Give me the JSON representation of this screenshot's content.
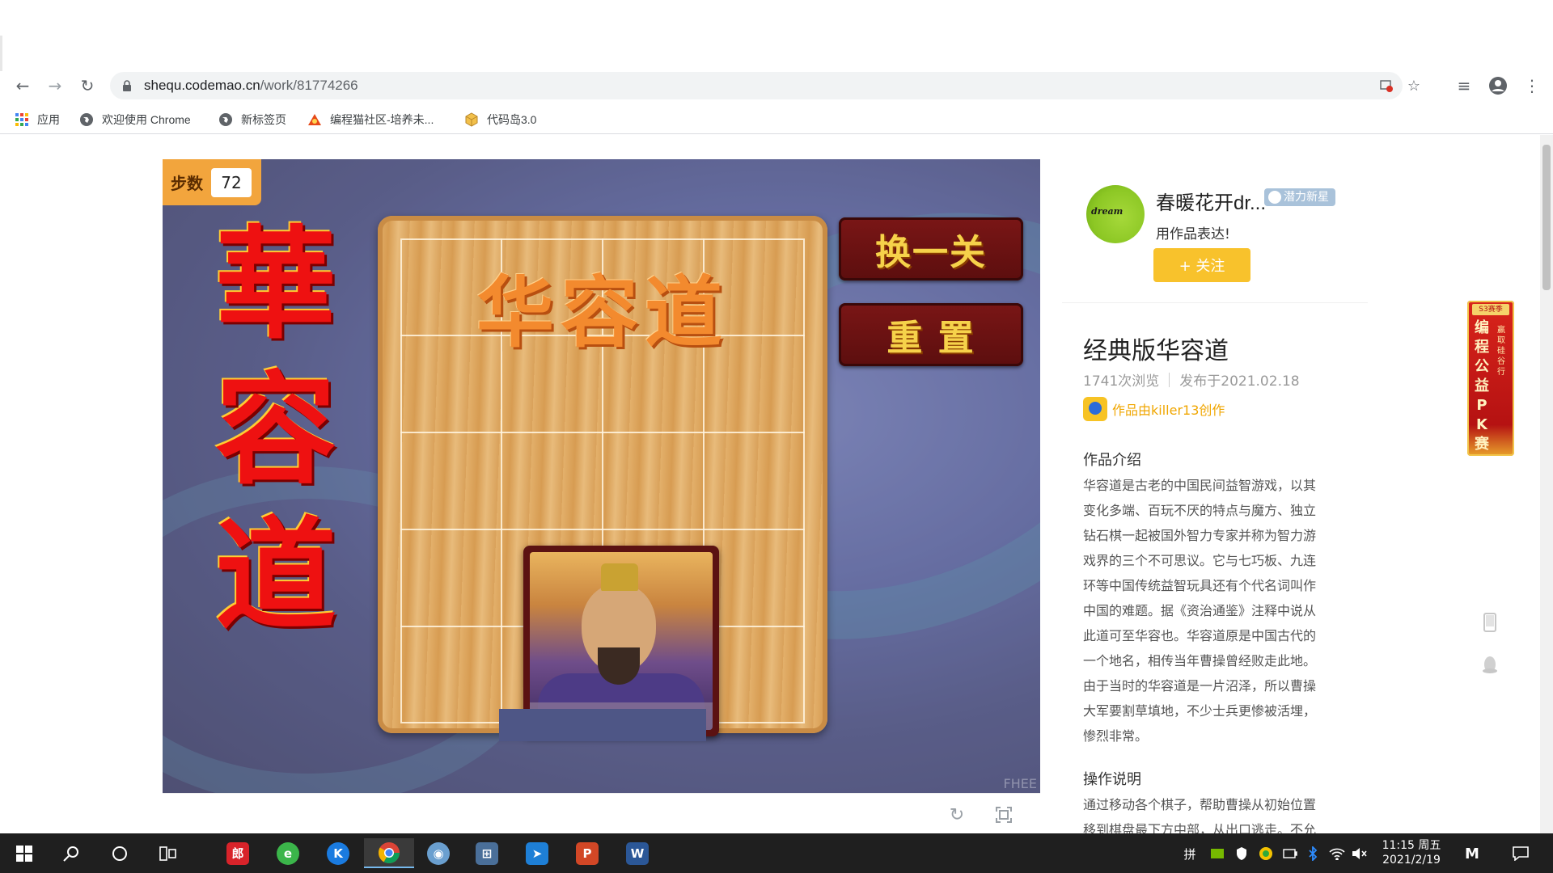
{
  "browser": {
    "url_host": "shequ.codemao.cn",
    "url_path": "/work/81774266",
    "bookmarks": [
      {
        "label": "应用",
        "icon": "apps-grid-icon"
      },
      {
        "label": "欢迎使用 Chrome",
        "icon": "globe-icon"
      },
      {
        "label": "新标签页",
        "icon": "globe-icon"
      },
      {
        "label": "编程猫社区-培养未...",
        "icon": "codemao-icon"
      },
      {
        "label": "代码岛3.0",
        "icon": "cube-icon"
      }
    ]
  },
  "game": {
    "steps_label": "步数",
    "steps_value": "72",
    "calligraphy": [
      "華",
      "容",
      "道"
    ],
    "board_title": "华容道",
    "piece_name": "曹操",
    "btn_next_level": "换一关",
    "btn_reset": "重 置",
    "watermark": "FHEE"
  },
  "author": {
    "name": "春暖花开dr...",
    "badge": "潜力新星",
    "avatar_text": "dream",
    "bio": "用作品表达!",
    "follow_label": "+ 关注"
  },
  "work": {
    "title": "经典版华容道",
    "views": "1741次浏览",
    "published": "发布于2021.02.18",
    "creator": "作品由killer13创作",
    "intro_heading": "作品介绍",
    "intro_lines": [
      "华容道是古老的中国民间益智游戏，以其",
      "变化多端、百玩不厌的特点与魔方、独立",
      "钻石棋一起被国外智力专家并称为智力游",
      "戏界的三个不可思议。它与七巧板、九连",
      "环等中国传统益智玩具还有个代名词叫作",
      "中国的难题。据《资治通鉴》注释中说从",
      "此道可至华容也。华容道原是中国古代的",
      "一个地名，相传当年曹操曾经败走此地。",
      "由于当时的华容道是一片沼泽，所以曹操",
      "大军要割草填地，不少士兵更惨被活埋，",
      "惨烈非常。"
    ],
    "howto_heading": "操作说明",
    "howto_lines": [
      "通过移动各个棋子，帮助曹操从初始位置",
      "移到棋盘最下方中部，从出口逃走。不允"
    ]
  },
  "pk_banner": {
    "tag": "S3赛季",
    "main": [
      "编",
      "程",
      "公",
      "益",
      "P",
      "K",
      "赛"
    ],
    "sub": [
      "赢",
      "取",
      "硅",
      "谷",
      "行"
    ]
  },
  "taskbar": {
    "time": "11:15 周五",
    "date": "2021/2/19",
    "input_method": "拼"
  }
}
